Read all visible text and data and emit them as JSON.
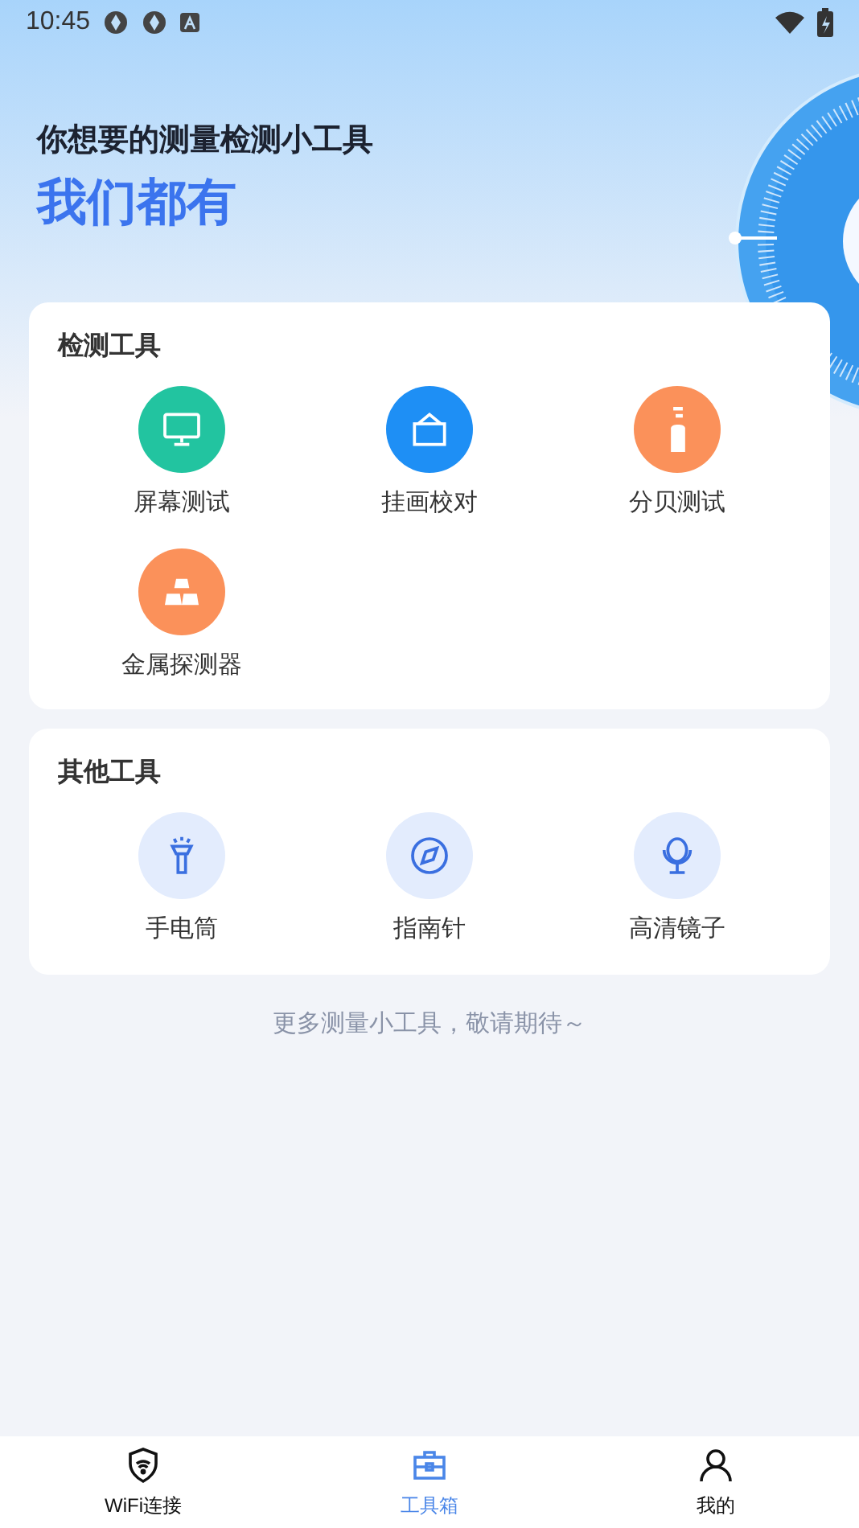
{
  "status_bar": {
    "time": "10:45"
  },
  "hero": {
    "subtitle": "你想要的测量检测小工具",
    "title": "我们都有"
  },
  "sections": [
    {
      "title": "检测工具",
      "tools": [
        {
          "label": "屏幕测试",
          "color": "#22c4a0"
        },
        {
          "label": "挂画校对",
          "color": "#1e8ff5"
        },
        {
          "label": "分贝测试",
          "color": "#fb915a"
        },
        {
          "label": "金属探测器",
          "color": "#fb915a"
        }
      ]
    },
    {
      "title": "其他工具",
      "tools": [
        {
          "label": "手电筒",
          "color": "#e3ecfd"
        },
        {
          "label": "指南针",
          "color": "#e3ecfd"
        },
        {
          "label": "高清镜子",
          "color": "#e3ecfd"
        }
      ]
    }
  ],
  "footnote": "更多测量小工具，敬请期待～",
  "tabs": [
    {
      "label": "WiFi连接",
      "selected": false
    },
    {
      "label": "工具箱",
      "selected": true
    },
    {
      "label": "我的",
      "selected": false
    }
  ]
}
